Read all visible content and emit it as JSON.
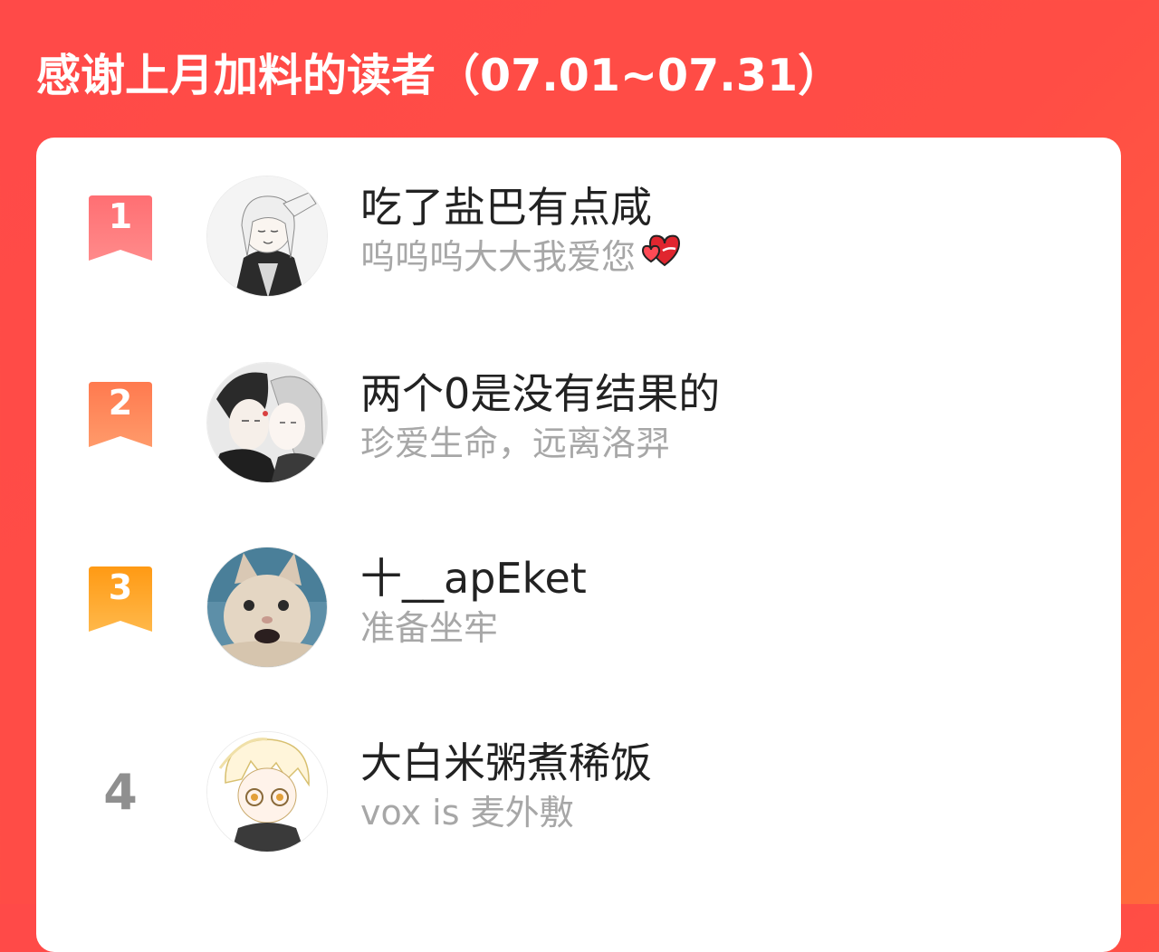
{
  "page_title": "感谢上月加料的读者（07.01~07.31）",
  "colors": {
    "background_start": "#ff4a48",
    "background_end": "#ff6a3c",
    "rank1": "#ff5a5f",
    "rank2": "#ff7a4f",
    "rank3": "#ff9e1c",
    "rank_plain": "#8f8f8f",
    "name_text": "#222222",
    "message_text": "#a7a7a7"
  },
  "readers": [
    {
      "rank": "1",
      "avatar": "anime-boy-avatar",
      "name": "吃了盐巴有点咸",
      "message": "呜呜呜大大我爱您",
      "message_emoji": "heart-emoji"
    },
    {
      "rank": "2",
      "avatar": "anime-couple-avatar",
      "name": "两个0是没有结果的",
      "message": "珍爱生命，远离洛羿"
    },
    {
      "rank": "3",
      "avatar": "cat-avatar",
      "name": "十__apEket",
      "message": "准备坐牢"
    },
    {
      "rank": "4",
      "avatar": "anime-blonde-avatar",
      "name": "大白米粥煮稀饭",
      "message": "vox is 麦外敷"
    }
  ]
}
